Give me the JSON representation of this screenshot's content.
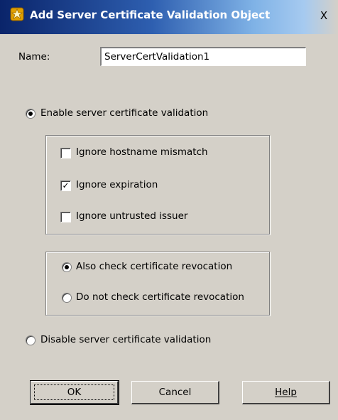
{
  "window": {
    "title": "Add Server Certificate Validation Object",
    "close_label": "X"
  },
  "form": {
    "name_label": "Name:",
    "name_value": "ServerCertValidation1",
    "enable_validation_label": "Enable server certificate validation",
    "enable_validation_selected": true,
    "disable_validation_label": "Disable server certificate validation",
    "disable_validation_selected": false,
    "options": [
      {
        "label": "Ignore hostname mismatch",
        "checked": false
      },
      {
        "label": "Ignore expiration",
        "checked": true
      },
      {
        "label": "Ignore untrusted issuer",
        "checked": false
      }
    ],
    "revocation": [
      {
        "label": "Also check certificate revocation",
        "selected": true
      },
      {
        "label": "Do not check certificate revocation",
        "selected": false
      }
    ]
  },
  "buttons": {
    "ok_label": "OK",
    "cancel_label": "Cancel",
    "help_label": "Help"
  },
  "icons": {
    "title_icon": "certificate-star-icon",
    "check_glyph": "✓"
  },
  "colors": {
    "dialog_bg": "#d4d0c8",
    "titlebar_start": "#0a246a",
    "titlebar_end": "#a6caf0"
  }
}
